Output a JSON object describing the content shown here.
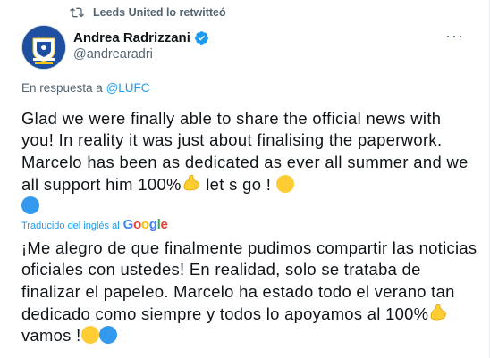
{
  "retweet": {
    "text": "Leeds United lo retwitteó",
    "icon": "retweet-icon"
  },
  "author": {
    "name": "Andrea Radrizzani",
    "handle": "@andrearadri",
    "verified": true,
    "avatar": "leeds-crest-avatar"
  },
  "reply": {
    "prefix": "En respuesta a",
    "mention": "@LUFC"
  },
  "tweet": {
    "text": "Glad we were finally able to share the official news with you! In reality it was just about finalising the paperwork. Marcelo has been as dedicated as ever all summer and we all support him 100%",
    "tail": " let s go ! "
  },
  "translation": {
    "label": "Traducido del inglés al",
    "provider_letters": [
      "G",
      "o",
      "o",
      "g",
      "l",
      "e"
    ],
    "provider_colors": [
      "#4285f4",
      "#ea4335",
      "#fbbc05",
      "#4285f4",
      "#34a853",
      "#ea4335"
    ],
    "text": "¡Me alegro de que finalmente pudimos compartir las noticias oficiales con ustedes! En realidad, solo se trataba de finalizar el papeleo. Marcelo ha estado todo el verano tan dedicado como siempre y todos lo apoyamos al 100%",
    "tail": " vamos !"
  },
  "colors": {
    "link": "#1d9bf0",
    "secondary_text": "#536471",
    "yellow_circle": "#ffcc33",
    "blue_circle": "#3399ee",
    "flex_emoji": "#ffcc33"
  }
}
